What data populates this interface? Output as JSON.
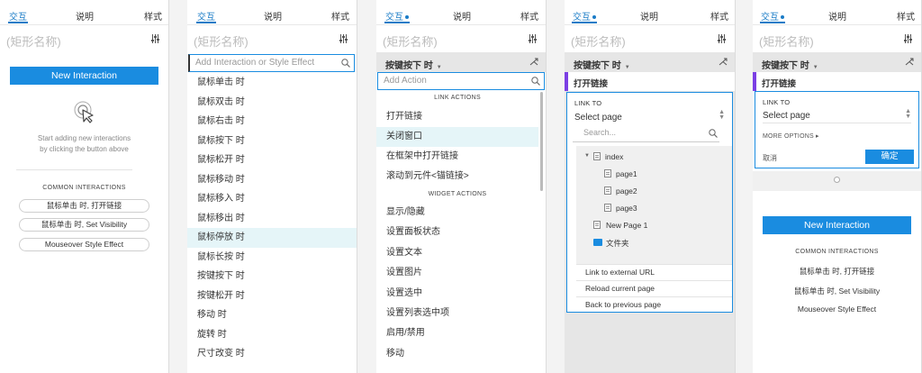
{
  "tabs": {
    "interactions": "交互",
    "notes": "说明",
    "style": "样式"
  },
  "shape_name": "(矩形名称)",
  "panel1": {
    "new_interaction_button": "New Interaction",
    "empty_hint_line1": "Start adding new interactions",
    "empty_hint_line2": "by clicking the button above",
    "common_title": "COMMON INTERACTIONS",
    "common_items": [
      "鼠标单击 时, 打开链接",
      "鼠标单击 时, Set Visibility",
      "Mouseover Style Effect"
    ]
  },
  "panel2": {
    "search_placeholder": "Add Interaction or Style Effect",
    "events": [
      "鼠标单击 时",
      "鼠标双击 时",
      "鼠标右击 时",
      "鼠标按下 时",
      "鼠标松开 时",
      "鼠标移动 时",
      "鼠标移入 时",
      "鼠标移出 时",
      "鼠标停放 时",
      "鼠标长按 时",
      "按键按下 时",
      "按键松开 时",
      "移动 时",
      "旋转 时",
      "尺寸改变 时"
    ],
    "highlighted_index": 8
  },
  "panel3": {
    "event_label": "按键按下 时",
    "action_placeholder": "Add Action",
    "link_actions_header": "LINK ACTIONS",
    "link_actions": [
      "打开链接",
      "关闭窗口",
      "在框架中打开链接",
      "滚动到元件<锚链接>"
    ],
    "highlighted_link": 1,
    "widget_actions_header": "WIDGET ACTIONS",
    "widget_actions": [
      "显示/隐藏",
      "设置面板状态",
      "设置文本",
      "设置图片",
      "设置选中",
      "设置列表选中项",
      "启用/禁用",
      "移动"
    ]
  },
  "panel4": {
    "event_label": "按键按下 时",
    "action_label": "打开链接",
    "link_to_label": "LINK TO",
    "select_value": "Select page",
    "search_placeholder": "Search...",
    "tree": {
      "root": "index",
      "children": [
        "page1",
        "page2",
        "page3"
      ],
      "new_page": "New Page 1",
      "folder": "文件夹"
    },
    "link_options": [
      "Link to external URL",
      "Reload current page",
      "Back to previous page"
    ]
  },
  "panel5": {
    "event_label": "按键按下 时",
    "action_label": "打开链接",
    "link_to_label": "LINK TO",
    "select_value": "Select page",
    "more_options": "MORE OPTIONS",
    "cancel_label": "取消",
    "ok_label": "确定",
    "new_interaction_button": "New Interaction",
    "common_title": "COMMON INTERACTIONS",
    "common_items": [
      "鼠标单击 时, 打开链接",
      "鼠标单击 时, Set Visibility",
      "Mouseover Style Effect"
    ]
  },
  "colors": {
    "accent": "#1a8ce0",
    "tab_active": "#1a7cc7",
    "highlight": "#e5f5f8",
    "action_bar": "#7b3fe4"
  }
}
